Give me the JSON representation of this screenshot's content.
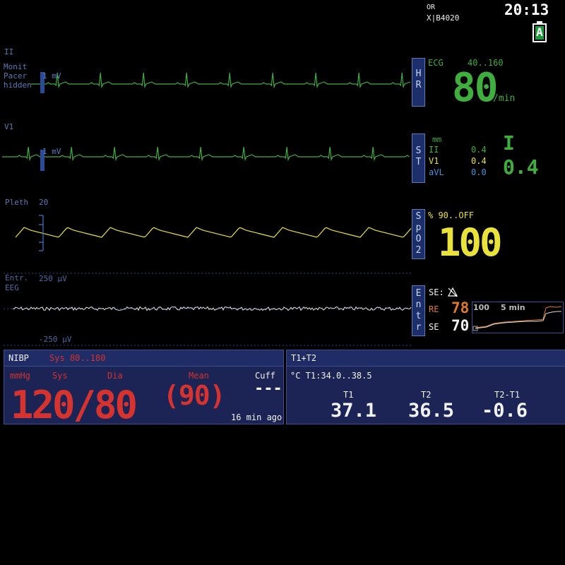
{
  "header": {
    "location": "OR",
    "bed": "X|B4020",
    "time": "20:13",
    "battery_label": "A"
  },
  "ecg_lead_ii": {
    "lead": "II",
    "mode_lines": [
      "Monit",
      "Pacer",
      "hidden"
    ],
    "scale": "1 mV"
  },
  "ecg_lead_v1": {
    "lead": "V1",
    "scale": "1 mV"
  },
  "pleth": {
    "label": "Pleth",
    "scale": "20"
  },
  "eeg": {
    "label_line1": "Entr.",
    "label_line2": "EEG",
    "top_scale": "250 µV",
    "bottom_scale": "-250 µV"
  },
  "hr_param": {
    "tab": [
      "H",
      "R"
    ],
    "source": "ECG",
    "limits": "40..160",
    "value": "80",
    "unit": "/min"
  },
  "st_param": {
    "tab": [
      "S",
      "T"
    ],
    "unit": "mm",
    "leads": [
      {
        "name": "II",
        "value": "0.4"
      },
      {
        "name": "V1",
        "value": "0.4"
      },
      {
        "name": "aVL",
        "value": "0.0"
      }
    ],
    "big_lead": "I",
    "big_value": "0.4"
  },
  "spo2_param": {
    "tab": [
      "S",
      "p",
      "O",
      "2"
    ],
    "limits": "% 90..OFF",
    "value": "100"
  },
  "entropy_param": {
    "tab": [
      "E",
      "n",
      "t",
      "r"
    ],
    "se_label": "SE:",
    "re_label": "RE",
    "re_value": "78",
    "se2_label": "SE",
    "se_value": "70",
    "trend_max": "100",
    "trend_span": "5 min"
  },
  "nibp": {
    "title": "NIBP",
    "limits": "Sys 80..180",
    "unit": "mmHg",
    "sys_label": "Sys",
    "dia_label": "Dia",
    "mean_label": "Mean",
    "cuff_label": "Cuff",
    "value": "120/80",
    "mean_value": "(90)",
    "cuff_value": "---",
    "age": "16 min ago"
  },
  "temp": {
    "title": "T1+T2",
    "limits": "°C T1:34.0..38.5",
    "t1_label": "T1",
    "t2_label": "T2",
    "diff_label": "T2-T1",
    "t1_value": "37.1",
    "t2_value": "36.5",
    "diff_value": "-0.6"
  },
  "colors": {
    "ecg": "#3fae3f",
    "spo2": "#e9e23a",
    "eeg": "#e6e6e6",
    "nibp": "#d4332f",
    "re": "#e07a2a",
    "panel": "#1b2454"
  }
}
